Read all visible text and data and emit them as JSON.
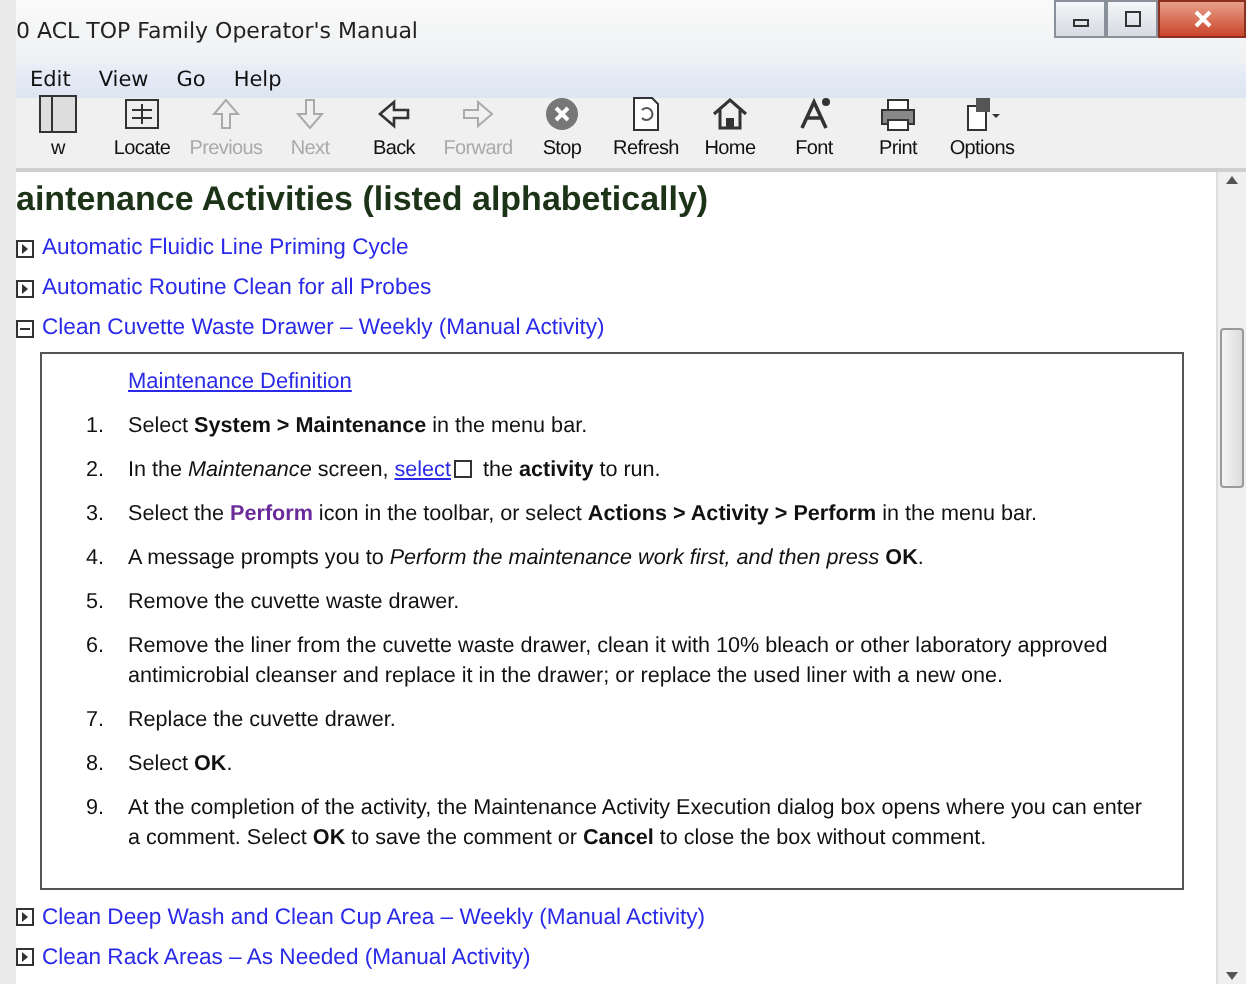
{
  "window": {
    "title": "0 ACL TOP Family Operator's Manual"
  },
  "menu": [
    "Edit",
    "View",
    "Go",
    "Help"
  ],
  "toolbar": [
    {
      "label": "w",
      "disabled": false
    },
    {
      "label": "Locate",
      "disabled": false
    },
    {
      "label": "Previous",
      "disabled": true
    },
    {
      "label": "Next",
      "disabled": true
    },
    {
      "label": "Back",
      "disabled": false
    },
    {
      "label": "Forward",
      "disabled": true
    },
    {
      "label": "Stop",
      "disabled": false
    },
    {
      "label": "Refresh",
      "disabled": false
    },
    {
      "label": "Home",
      "disabled": false
    },
    {
      "label": "Font",
      "disabled": false
    },
    {
      "label": "Print",
      "disabled": false
    },
    {
      "label": "Options",
      "disabled": false
    }
  ],
  "heading": "aintenance Activities (listed alphabetically)",
  "topics": [
    {
      "label": "Automatic Fluidic Line Priming Cycle",
      "expanded": false
    },
    {
      "label": "Automatic Routine Clean for all Probes",
      "expanded": false
    },
    {
      "label": "Clean Cuvette Waste Drawer – Weekly (Manual Activity)",
      "expanded": true,
      "definition_link": "Maintenance Definition",
      "steps": [
        {
          "number": "1.",
          "parts": [
            {
              "kind": "plain",
              "text": "Select "
            },
            {
              "kind": "bold",
              "text": "System > Maintenance"
            },
            {
              "kind": "plain",
              "text": " in the menu bar."
            }
          ]
        },
        {
          "number": "2.",
          "parts": [
            {
              "kind": "plain",
              "text": "In the "
            },
            {
              "kind": "italic",
              "text": "Maintenance"
            },
            {
              "kind": "plain",
              "text": " screen, "
            },
            {
              "kind": "link",
              "text": "select"
            },
            {
              "kind": "icon"
            },
            {
              "kind": "plain",
              "text": " the "
            },
            {
              "kind": "bold",
              "text": "activity"
            },
            {
              "kind": "plain",
              "text": " to run."
            }
          ]
        },
        {
          "number": "3.",
          "parts": [
            {
              "kind": "plain",
              "text": "Select the "
            },
            {
              "kind": "highlight",
              "text": "Perform"
            },
            {
              "kind": "plain",
              "text": " icon in the toolbar, or select "
            },
            {
              "kind": "bold",
              "text": "Actions > Activity > Perform"
            },
            {
              "kind": "plain",
              "text": " in the menu bar."
            }
          ]
        },
        {
          "number": "4.",
          "parts": [
            {
              "kind": "plain",
              "text": "A message prompts you to "
            },
            {
              "kind": "italic",
              "text": "Perform the maintenance work first, and then press "
            },
            {
              "kind": "bold",
              "text": "OK"
            },
            {
              "kind": "plain",
              "text": "."
            }
          ]
        },
        {
          "number": "5.",
          "parts": [
            {
              "kind": "plain",
              "text": "Remove the cuvette waste drawer."
            }
          ]
        },
        {
          "number": "6.",
          "parts": [
            {
              "kind": "plain",
              "text": "Remove the liner from the cuvette waste drawer, clean it with 10% bleach or other laboratory approved antimicrobial cleanser and replace it in the drawer; or replace the used liner with a new one."
            }
          ]
        },
        {
          "number": "7.",
          "parts": [
            {
              "kind": "plain",
              "text": "Replace the cuvette drawer."
            }
          ]
        },
        {
          "number": "8.",
          "parts": [
            {
              "kind": "plain",
              "text": "Select "
            },
            {
              "kind": "bold",
              "text": "OK"
            },
            {
              "kind": "plain",
              "text": "."
            }
          ]
        },
        {
          "number": "9.",
          "parts": [
            {
              "kind": "plain",
              "text": "At the completion of the activity, the Maintenance Activity Execution dialog box opens where you can enter a comment. Select "
            },
            {
              "kind": "bold",
              "text": "OK"
            },
            {
              "kind": "plain",
              "text": " to save the comment or "
            },
            {
              "kind": "bold",
              "text": "Cancel"
            },
            {
              "kind": "plain",
              "text": " to close the box without comment."
            }
          ]
        }
      ]
    },
    {
      "label": "Clean Deep Wash and Clean Cup Area – Weekly (Manual Activity)",
      "expanded": false
    },
    {
      "label": "Clean Rack Areas – As Needed (Manual Activity)",
      "expanded": false
    }
  ]
}
